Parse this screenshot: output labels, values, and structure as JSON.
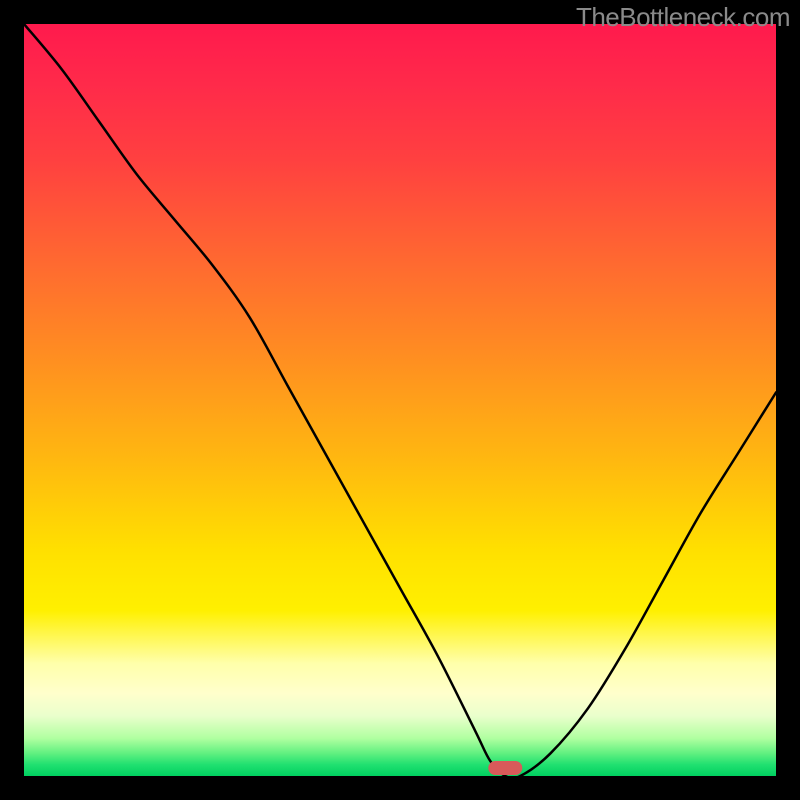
{
  "watermark": "TheBottleneck.com",
  "chart_data": {
    "type": "line",
    "title": "",
    "xlabel": "",
    "ylabel": "",
    "xlim": [
      0,
      100
    ],
    "ylim": [
      0,
      100
    ],
    "grid": false,
    "legend": null,
    "x": [
      0,
      5,
      10,
      15,
      20,
      25,
      30,
      35,
      40,
      45,
      50,
      55,
      60,
      62,
      64,
      66,
      70,
      75,
      80,
      85,
      90,
      95,
      100
    ],
    "values": [
      100,
      94,
      87,
      80,
      74,
      68,
      61,
      52,
      43,
      34,
      25,
      16,
      6,
      2,
      0,
      0,
      3,
      9,
      17,
      26,
      35,
      43,
      51
    ],
    "optimal_marker_x": 64,
    "marker_color": "#d85a5a"
  }
}
